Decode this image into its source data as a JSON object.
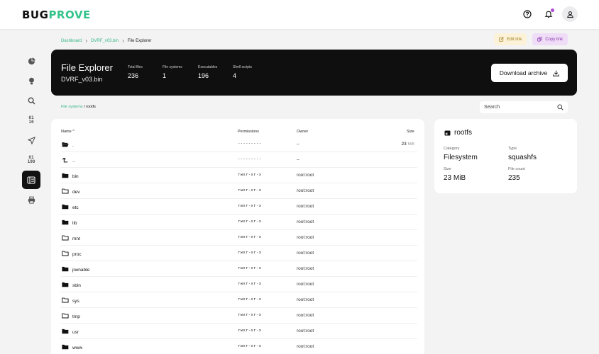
{
  "app": {
    "logo_part1": "BUG",
    "logo_part2": "PROVE"
  },
  "breadcrumb": {
    "items": [
      "Dashboard",
      "DVRF_v03.bin",
      "File Explorer"
    ]
  },
  "actions": {
    "edit_link": "Edit link",
    "copy_link": "Copy link"
  },
  "hero": {
    "title": "File Explorer",
    "subtitle": "DVRF_v03.bin",
    "stats": [
      {
        "label": "Total files",
        "value": "236"
      },
      {
        "label": "File systems",
        "value": "1"
      },
      {
        "label": "Executables",
        "value": "196"
      },
      {
        "label": "Shell scripts",
        "value": "4"
      }
    ],
    "download_label": "Download archive"
  },
  "path": {
    "root": "File systems",
    "sep": " / ",
    "current": "rootfs"
  },
  "search": {
    "placeholder": "Search"
  },
  "table": {
    "headers": {
      "name": "Name",
      "permissions": "Permissions",
      "owner": "Owner",
      "size": "Size"
    },
    "rows": [
      {
        "name": ".",
        "icon": "folder-open-icon",
        "permissions": "---------",
        "owner": "–",
        "size_num": "23",
        "size_unit": "MiB"
      },
      {
        "name": "..",
        "icon": "arrow-up-icon",
        "permissions": "---------",
        "owner": "–",
        "size_num": "",
        "size_unit": ""
      },
      {
        "name": "bin",
        "icon": "folder-filled-icon",
        "permissions": "rwxr-xr-x",
        "owner": "root:root",
        "size_num": "",
        "size_unit": ""
      },
      {
        "name": "dev",
        "icon": "folder-outline-icon",
        "permissions": "rwxr-xr-x",
        "owner": "root:root",
        "size_num": "",
        "size_unit": ""
      },
      {
        "name": "etc",
        "icon": "folder-filled-icon",
        "permissions": "rwxr-xr-x",
        "owner": "root:root",
        "size_num": "",
        "size_unit": ""
      },
      {
        "name": "lib",
        "icon": "folder-filled-icon",
        "permissions": "rwxr-xr-x",
        "owner": "root:root",
        "size_num": "",
        "size_unit": ""
      },
      {
        "name": "mnt",
        "icon": "folder-outline-icon",
        "permissions": "rwxr-xr-x",
        "owner": "root:root",
        "size_num": "",
        "size_unit": ""
      },
      {
        "name": "proc",
        "icon": "folder-outline-icon",
        "permissions": "rwxr-xr-x",
        "owner": "root:root",
        "size_num": "",
        "size_unit": ""
      },
      {
        "name": "pwnable",
        "icon": "folder-filled-icon",
        "permissions": "rwxr-xr-x",
        "owner": "root:root",
        "size_num": "",
        "size_unit": ""
      },
      {
        "name": "sbin",
        "icon": "folder-filled-icon",
        "permissions": "rwxr-xr-x",
        "owner": "root:root",
        "size_num": "",
        "size_unit": ""
      },
      {
        "name": "sys",
        "icon": "folder-outline-icon",
        "permissions": "rwxr-xr-x",
        "owner": "root:root",
        "size_num": "",
        "size_unit": ""
      },
      {
        "name": "tmp",
        "icon": "folder-outline-icon",
        "permissions": "rwxr-xr-x",
        "owner": "root:root",
        "size_num": "",
        "size_unit": ""
      },
      {
        "name": "usr",
        "icon": "folder-filled-icon",
        "permissions": "rwxr-xr-x",
        "owner": "root:root",
        "size_num": "",
        "size_unit": ""
      },
      {
        "name": "www",
        "icon": "folder-filled-icon",
        "permissions": "rwxr-xr-x",
        "owner": "root:root",
        "size_num": "",
        "size_unit": ""
      }
    ]
  },
  "info": {
    "title": "rootfs",
    "category_label": "Category",
    "category": "Filesystem",
    "type_label": "Type",
    "type": "squashfs",
    "size_label": "Size",
    "size": "23 MiB",
    "filecount_label": "File count",
    "filecount": "235"
  },
  "colors": {
    "accent_green": "#35c38b",
    "accent_purple": "#b04ad6",
    "hero_bg": "#0f0f10"
  }
}
